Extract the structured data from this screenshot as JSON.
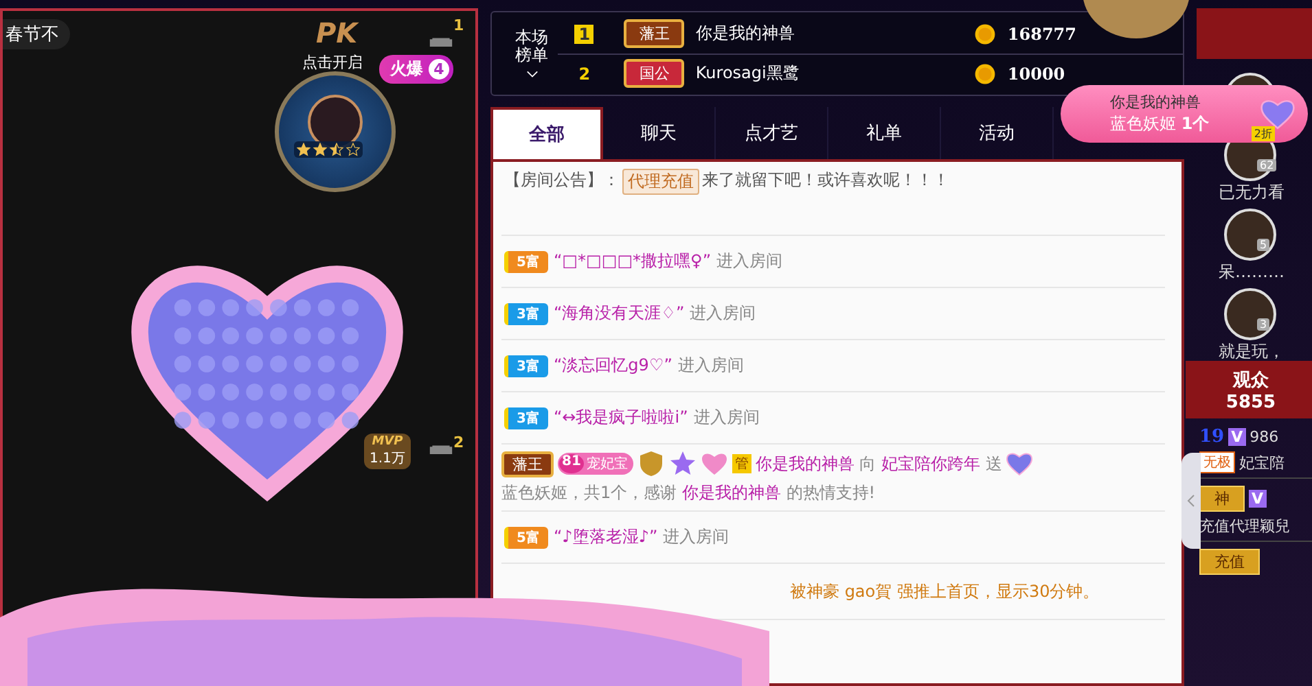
{
  "video": {
    "banner": "春节不",
    "pk_label": "PK",
    "pk_hint": "点击开启",
    "hot_label": "火爆",
    "hot_count": "4",
    "seat_1": "1",
    "seat_2": "2",
    "mvp_label": "MVP",
    "mvp_value": "1.1万",
    "host": {
      "stars": 2.5
    }
  },
  "ranking": {
    "label": "本场榜单",
    "rows": [
      {
        "rank": "1",
        "title": "藩王",
        "color": "#8a3a10",
        "name": "你是我的神兽",
        "coins": "168777"
      },
      {
        "rank": "2",
        "title": "国公",
        "color": "#c8283a",
        "name": "Kurosagi黑鹭",
        "coins": "10000"
      }
    ]
  },
  "gift_toast": {
    "sender": "你是我的神兽",
    "gift": "蓝色妖姬",
    "count": "1个",
    "discount": "2折"
  },
  "tabs": [
    {
      "label": "全部",
      "selected": true
    },
    {
      "label": "聊天",
      "selected": false
    },
    {
      "label": "点才艺",
      "selected": false
    },
    {
      "label": "礼单",
      "selected": false
    },
    {
      "label": "活动",
      "selected": false
    }
  ],
  "chat": [
    {
      "kind": "notice",
      "prefix": "【房间公告】：",
      "tag": "代理充值",
      "text": "来了就留下吧！或许喜欢呢！！！"
    },
    {
      "kind": "enter",
      "badge": "5富",
      "color": "#f08a1e",
      "name": "“□*□□□*撒拉嘿♀”",
      "text": "进入房间"
    },
    {
      "kind": "enter",
      "badge": "3富",
      "color": "#1a9be8",
      "name": "“海角没有天涯♢”",
      "text": "进入房间"
    },
    {
      "kind": "enter",
      "badge": "3富",
      "color": "#1a9be8",
      "name": "“淡忘回忆g9♡”",
      "text": "进入房间"
    },
    {
      "kind": "enter",
      "badge": "3富",
      "color": "#1a9be8",
      "name": "“↔我是疯子啦啦i”",
      "text": "进入房间"
    },
    {
      "kind": "gift",
      "title": "藩王",
      "fan_level": "81",
      "fan_name": "宠妃宝",
      "role": "管",
      "part_1": [
        {
          "text": "你是我的神兽",
          "kind": "user"
        },
        {
          "text": " 向 ",
          "kind": "plain"
        },
        {
          "text": "妃宝陪你跨年",
          "kind": "user"
        },
        {
          "text": " 送",
          "kind": "plain"
        }
      ],
      "part_2": [
        {
          "text": "蓝色妖姬，共1个，感谢 ",
          "kind": "plain"
        },
        {
          "text": "你是我的神兽",
          "kind": "user"
        },
        {
          "text": " 的热情支持!",
          "kind": "plain"
        }
      ]
    },
    {
      "kind": "enter",
      "badge": "5富",
      "color": "#f08a1e",
      "name": "“♪堕落老湿♪”",
      "text": "进入房间"
    },
    {
      "kind": "push",
      "text": "被神豪 gao賀 强推上首页，显示30分钟。"
    }
  ],
  "guardians": [
    {
      "name": "已无力看",
      "level": "62"
    },
    {
      "name": "呆………",
      "level": "5"
    },
    {
      "name": "就是玩，",
      "level": "3"
    }
  ],
  "audience": {
    "label": "观众",
    "count": "5855",
    "level": "19",
    "vip": "V",
    "id": "986",
    "rank": "无极",
    "name": "妃宝陪",
    "badge_2": "神",
    "vip_2": "V",
    "name_2": "充值代理颖兒",
    "badge_3": "充值"
  }
}
